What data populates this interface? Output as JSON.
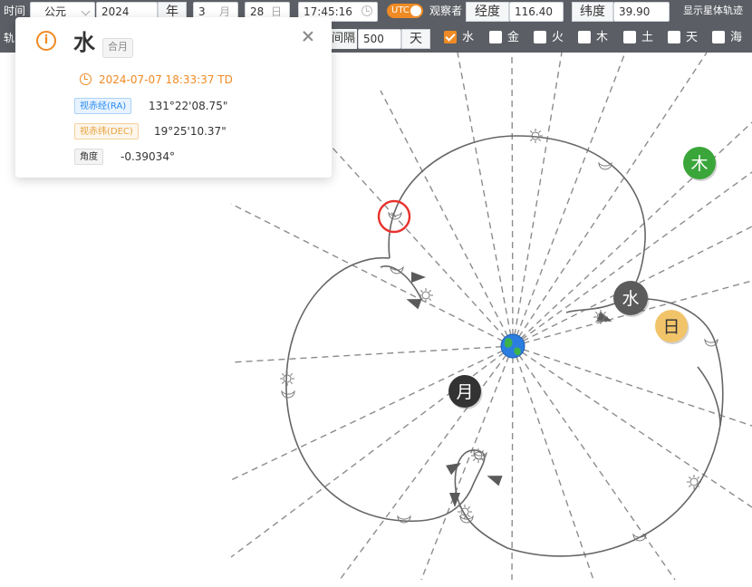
{
  "controls": {
    "time_label": "时间",
    "era_value": "公元",
    "year_value": "2024",
    "year_unit": "年",
    "month_value": "3",
    "month_unit": "月",
    "day_value": "28",
    "day_unit": "日",
    "clock_value": "17:45:16",
    "utc_label": "UTC",
    "observer_label": "观察者",
    "longitude_label": "经度",
    "longitude_value": "116.40",
    "latitude_label": "纬度",
    "latitude_value": "39.90",
    "show_track_label": "显示星体轨迹",
    "track_label": "轨",
    "interval_label": "间隔",
    "interval_value": "500",
    "interval_unit": "天",
    "planets": [
      {
        "label": "水",
        "checked": true
      },
      {
        "label": "金",
        "checked": false
      },
      {
        "label": "火",
        "checked": false
      },
      {
        "label": "木",
        "checked": false
      },
      {
        "label": "土",
        "checked": false
      },
      {
        "label": "天",
        "checked": false
      },
      {
        "label": "海",
        "checked": false
      }
    ]
  },
  "popup": {
    "title": "水",
    "tag": "合月",
    "datetime": "2024-07-07 18:33:37 TD",
    "ra_label": "视赤经(RA)",
    "ra_value": "131°22'08.75\"",
    "dec_label": "视赤纬(DEC)",
    "dec_value": "19°25'10.37\"",
    "angle_label": "角度",
    "angle_value": "-0.39034°"
  },
  "sky": {
    "bodies": [
      {
        "label": "水",
        "color": "#5b5b5b"
      },
      {
        "label": "日",
        "color": "#f2c46a"
      },
      {
        "label": "月",
        "color": "#333333"
      },
      {
        "label": "木",
        "color": "#3aa63a"
      }
    ],
    "earth_icon": "earth-icon",
    "highlight_color": "#e8322d",
    "track_color": "#666666"
  }
}
